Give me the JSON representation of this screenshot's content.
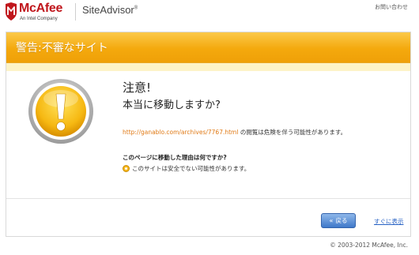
{
  "header": {
    "brand_name": "McAfee",
    "brand_tagline": "An Intel Company",
    "product_name": "SiteAdvisor",
    "product_mark": "®",
    "contact_link": "お問い合わせ"
  },
  "warning": {
    "banner_title": "警告:不審なサイト",
    "heading": "注意!",
    "subheading": "本当に移動しますか?",
    "url": "http://ganablo.com/archives/7767.html",
    "url_suffix": " の閲覧は危険を伴う可能性があります。",
    "question": "このページに移動した理由は何ですか?",
    "reason": "このサイトは安全でない可能性があります。"
  },
  "actions": {
    "back_label": "戻る",
    "show_label": "すぐに表示"
  },
  "footer": {
    "copyright": "© 2003-2012 McAfee, Inc."
  },
  "colors": {
    "brand_red": "#c0161c",
    "banner_orange": "#f4a90d",
    "link_orange": "#e07a16",
    "link_blue": "#2a64c5"
  },
  "icons": {
    "logo": "mcafee-shield-icon",
    "alert": "exclamation-icon",
    "back": "double-chevron-left-icon"
  }
}
